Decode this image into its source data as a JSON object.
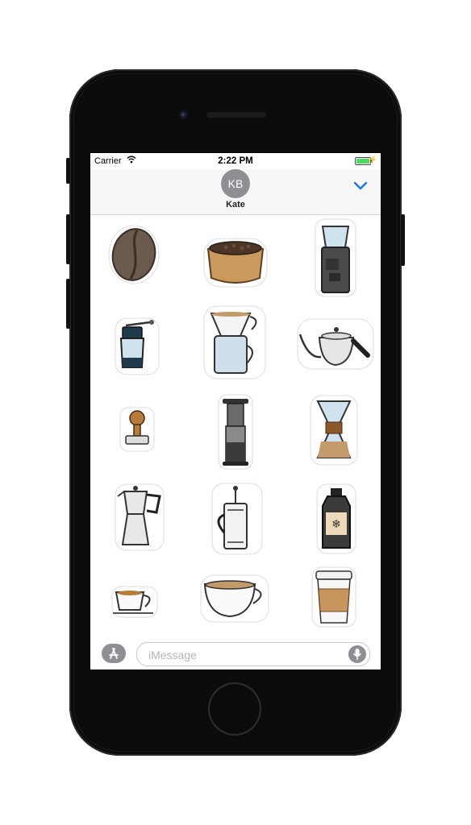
{
  "status_bar": {
    "carrier": "Carrier",
    "time": "2:22 PM",
    "battery_level": 1.0
  },
  "conversation": {
    "contact_initials": "KB",
    "contact_name": "Kate"
  },
  "sticker_grid": [
    {
      "icon": "coffee-bean-icon"
    },
    {
      "icon": "coffee-sack-icon"
    },
    {
      "icon": "electric-grinder-icon"
    },
    {
      "icon": "hand-grinder-icon"
    },
    {
      "icon": "pour-over-dripper-icon"
    },
    {
      "icon": "gooseneck-kettle-icon"
    },
    {
      "icon": "espresso-tamper-icon"
    },
    {
      "icon": "aeropress-icon"
    },
    {
      "icon": "chemex-icon"
    },
    {
      "icon": "moka-pot-icon"
    },
    {
      "icon": "french-press-icon"
    },
    {
      "icon": "cold-brew-bottle-icon"
    },
    {
      "icon": "espresso-cup-icon"
    },
    {
      "icon": "latte-cup-icon"
    },
    {
      "icon": "takeaway-cup-icon"
    }
  ],
  "compose": {
    "placeholder": "iMessage"
  },
  "colors": {
    "accent": "#1a73e8",
    "battery": "#4cd964",
    "avatar": "#8e8e93"
  }
}
